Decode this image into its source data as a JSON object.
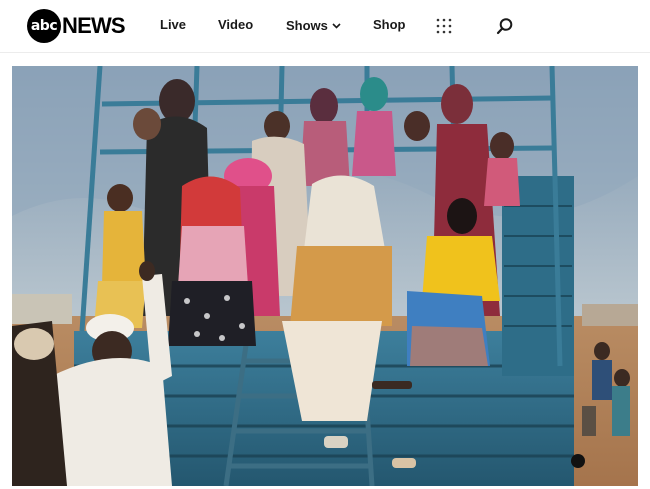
{
  "header": {
    "logo_abc": "abc",
    "logo_news": "NEWS",
    "nav": {
      "live": "Live",
      "video": "Video",
      "shows": "Shows",
      "shop": "Shop"
    },
    "icons": [
      "grid-menu-icon",
      "search-icon",
      "chevron-down-icon"
    ]
  },
  "photo": {
    "subject": "people-on-truck-photo"
  },
  "colors": {
    "header_bg": "#ffffff",
    "text": "#1a1a1a",
    "logo": "#000000",
    "truck_blue": "#2f6f8c"
  }
}
